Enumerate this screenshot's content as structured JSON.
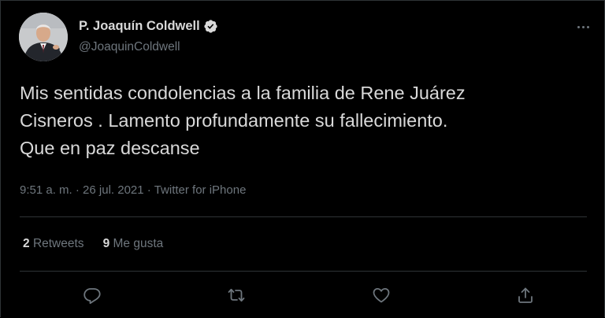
{
  "author": {
    "display_name": "P. Joaquín Coldwell",
    "handle": "@JoaquinColdwell",
    "verified": true
  },
  "tweet": {
    "text_lines": [
      "Mis sentidas condolencias a la familia de Rene Juárez",
      "Cisneros . Lamento profundamente su fallecimiento.",
      "Que en paz descanse"
    ],
    "time": "9:51 a. m.",
    "separator": "·",
    "date": "26 jul. 2021",
    "source": "Twitter for iPhone"
  },
  "stats": {
    "retweets_count": "2",
    "retweets_label": "Retweets",
    "likes_count": "9",
    "likes_label": "Me gusta"
  },
  "actions": {
    "reply": "reply-icon",
    "retweet": "retweet-icon",
    "like": "heart-icon",
    "share": "share-icon"
  },
  "colors": {
    "background": "#000000",
    "primary_text": "#d9d9d9",
    "secondary_text": "#6e767d",
    "divider": "#2f3336",
    "verified_badge": "#d9d9d9"
  }
}
